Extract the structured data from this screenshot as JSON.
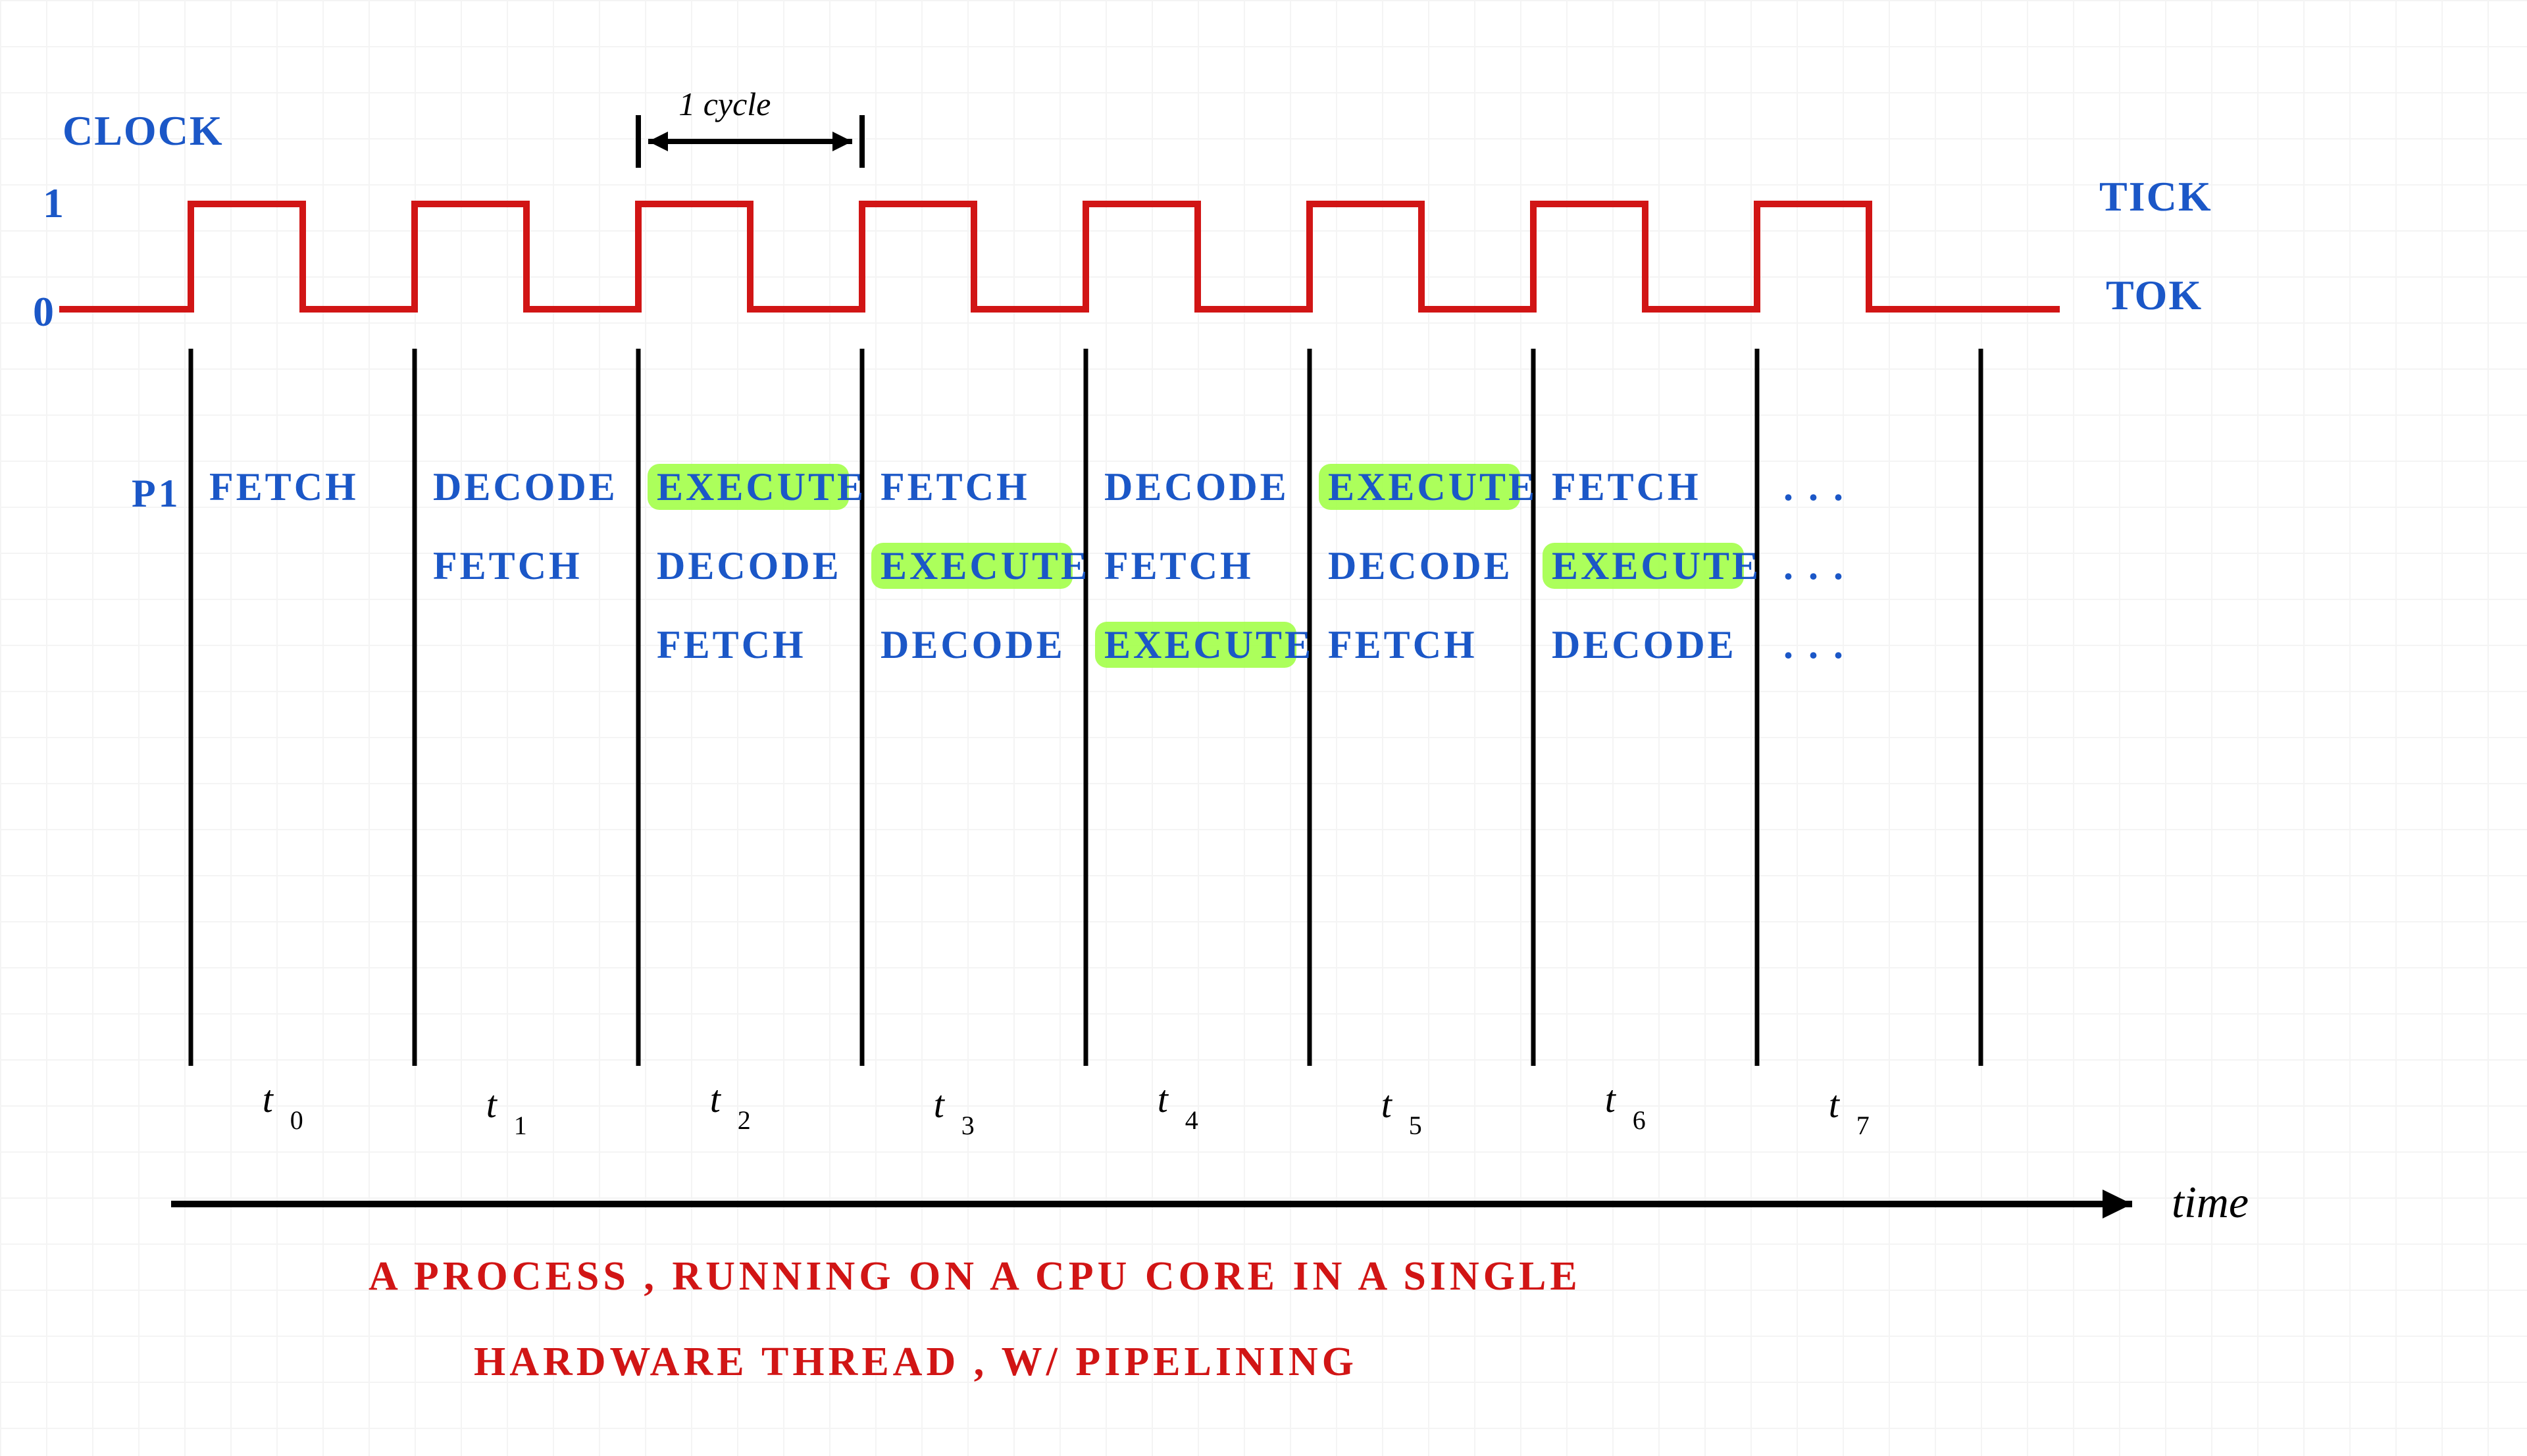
{
  "chart_data": {
    "type": "diagram",
    "title_line1": "A PROCESS , RUNNING ON A CPU CORE IN A SINGLE",
    "title_line2": "HARDWARE THREAD , W/ PIPELINING",
    "clock": {
      "label": "CLOCK",
      "high": "1",
      "low": "0",
      "high_state_label": "TICK",
      "low_state_label": "TOK",
      "cycle_annotation": "1 cycle",
      "cycles_shown": 8
    },
    "time_axis_label": "time",
    "time_steps": [
      "t",
      "t",
      "t",
      "t",
      "t",
      "t",
      "t",
      "t"
    ],
    "time_step_subscripts": [
      "0",
      "1",
      "2",
      "3",
      "4",
      "5",
      "6",
      "7"
    ],
    "pipeline_label": "P1",
    "continuation": ". . .",
    "stage_names": {
      "F": "FETCH",
      "D": "DECODE",
      "E": "EXECUTE"
    },
    "pipeline": {
      "rows": [
        {
          "start_step": 0,
          "cells": [
            "F",
            "D",
            "E",
            "F",
            "D",
            "E",
            "F"
          ]
        },
        {
          "start_step": 1,
          "cells": [
            "F",
            "D",
            "E",
            "F",
            "D",
            "E"
          ]
        },
        {
          "start_step": 2,
          "cells": [
            "F",
            "D",
            "E",
            "F",
            "D"
          ]
        }
      ],
      "highlighted_stage": "E"
    }
  },
  "colors": {
    "ink_blue": "#1b57c7",
    "ink_red": "#d11515",
    "ink_black": "#000000",
    "highlight": "#9dff3e"
  }
}
